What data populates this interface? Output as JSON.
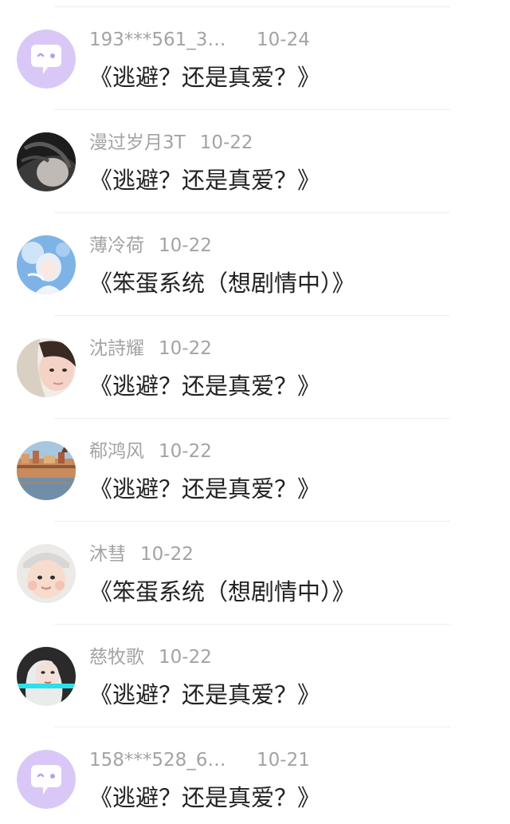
{
  "items": [
    {
      "name": "193***561_30...",
      "date": "10-24",
      "title": "《逃避？还是真爱？》",
      "avatar": "default-chat-avatar"
    },
    {
      "name": "漫过岁月3T",
      "date": "10-22",
      "title": "《逃避？还是真爱？》",
      "avatar": "dark-hair-photo-avatar"
    },
    {
      "name": "薄冷荷",
      "date": "10-22",
      "title": "《笨蛋系统（想剧情中）》",
      "avatar": "anime-girl-avatar"
    },
    {
      "name": "沈詩耀",
      "date": "10-22",
      "title": "《逃避？还是真爱？》",
      "avatar": "girl-photo-avatar"
    },
    {
      "name": "郗鸿风",
      "date": "10-22",
      "title": "《逃避？还是真爱？》",
      "avatar": "city-harbor-avatar"
    },
    {
      "name": "沐彗",
      "date": "10-22",
      "title": "《笨蛋系统（想剧情中）》",
      "avatar": "baby-photo-avatar"
    },
    {
      "name": "慈牧歌",
      "date": "10-22",
      "title": "《逃避？还是真爱？》",
      "avatar": "woman-portrait-avatar"
    },
    {
      "name": "158***528_68...",
      "date": "10-21",
      "title": "《逃避？还是真爱？》",
      "avatar": "default-chat-avatar"
    }
  ],
  "colors": {
    "default_avatar_bg": "#d9c8f7",
    "default_avatar_fg": "#ffffff",
    "meta_text": "#a3a3a3",
    "title_text": "#222222",
    "divider": "#eeeeee"
  }
}
